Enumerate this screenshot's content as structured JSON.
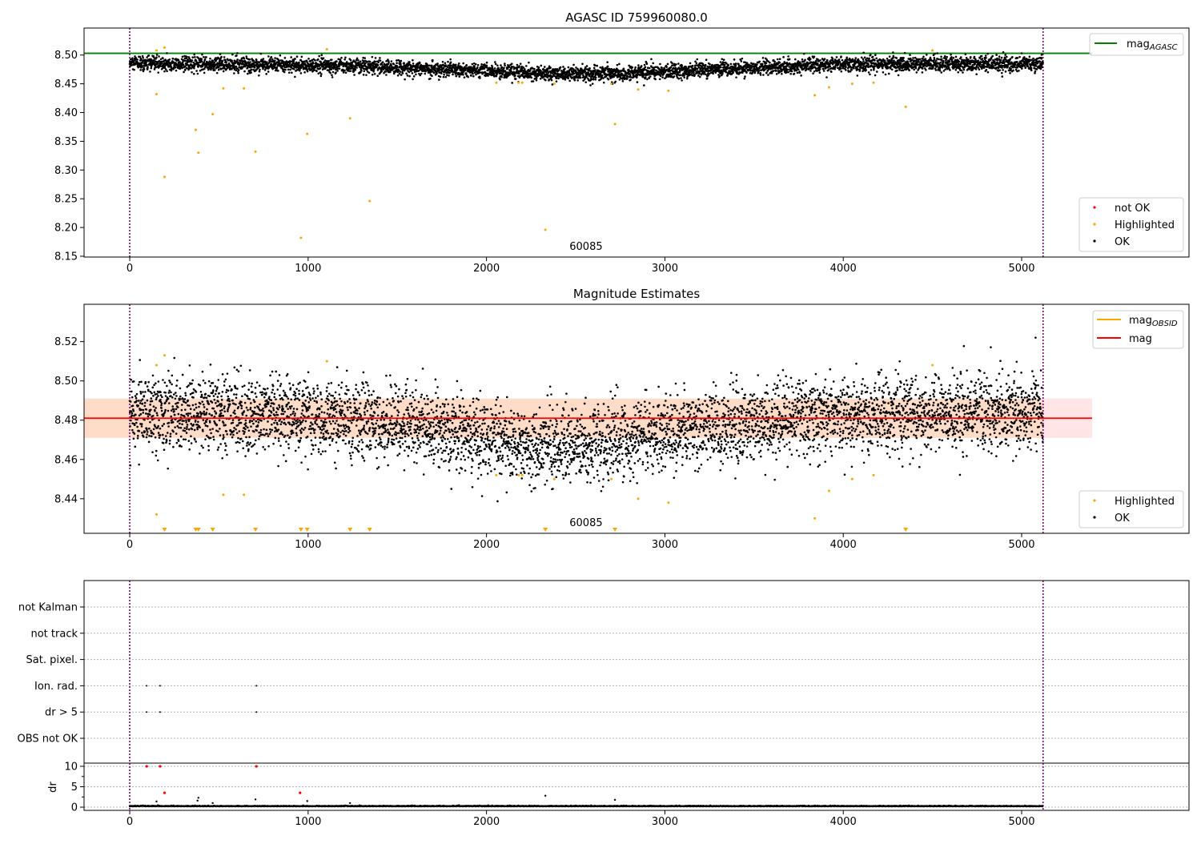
{
  "chart_data": [
    {
      "panel": "agasc",
      "type": "scatter",
      "title": "AGASC ID 759960080.0",
      "xlim": [
        -256,
        5938
      ],
      "ylim": [
        8.1486,
        8.547
      ],
      "xticks": [
        0,
        1000,
        2000,
        3000,
        4000,
        5000
      ],
      "xtick_labels": [
        "0",
        "1000",
        "2000",
        "3000",
        "4000",
        "5000"
      ],
      "yticks": [
        8.15,
        8.2,
        8.25,
        8.3,
        8.35,
        8.4,
        8.45,
        8.5
      ],
      "ytick_labels": [
        "8.15",
        "8.20",
        "8.25",
        "8.30",
        "8.35",
        "8.40",
        "8.45",
        "8.50"
      ],
      "annotation": {
        "text": "60085",
        "x": 2558
      },
      "vlines": [
        0,
        5120
      ],
      "mag_agasc": 8.503,
      "ok_series": {
        "count": 5120,
        "x_range": [
          0,
          5120
        ],
        "trend": [
          [
            0,
            8.485
          ],
          [
            800,
            8.483
          ],
          [
            1500,
            8.479
          ],
          [
            2000,
            8.472
          ],
          [
            2400,
            8.468
          ],
          [
            2800,
            8.469
          ],
          [
            3300,
            8.475
          ],
          [
            4000,
            8.484
          ],
          [
            5120,
            8.485
          ]
        ],
        "noise_sd": 0.0065
      },
      "highlighted": [
        [
          150,
          8.508
        ],
        [
          195,
          8.513
        ],
        [
          150,
          8.432
        ],
        [
          195,
          8.288
        ],
        [
          370,
          8.37
        ],
        [
          385,
          8.33
        ],
        [
          465,
          8.397
        ],
        [
          525,
          8.442
        ],
        [
          640,
          8.442
        ],
        [
          705,
          8.332
        ],
        [
          960,
          8.182
        ],
        [
          995,
          8.363
        ],
        [
          1105,
          8.51
        ],
        [
          1235,
          8.39
        ],
        [
          1345,
          8.246
        ],
        [
          2055,
          8.452
        ],
        [
          2180,
          8.452
        ],
        [
          2200,
          8.452
        ],
        [
          2330,
          8.196
        ],
        [
          2380,
          8.45
        ],
        [
          2700,
          8.45
        ],
        [
          2720,
          8.38
        ],
        [
          2850,
          8.44
        ],
        [
          3020,
          8.438
        ],
        [
          3840,
          8.43
        ],
        [
          3920,
          8.444
        ],
        [
          4050,
          8.45
        ],
        [
          4170,
          8.452
        ],
        [
          4350,
          8.41
        ],
        [
          4500,
          8.508
        ]
      ],
      "not_ok": [],
      "legend_top": {
        "line_label": "mag",
        "line_sub": "AGASC"
      },
      "legend_bottom": [
        "not OK",
        "Highlighted",
        "OK"
      ]
    },
    {
      "panel": "estimates",
      "type": "scatter",
      "title": "Magnitude Estimates",
      "xlim": [
        -256,
        5938
      ],
      "ylim": [
        8.4224,
        8.539
      ],
      "xticks": [
        0,
        1000,
        2000,
        3000,
        4000,
        5000
      ],
      "xtick_labels": [
        "0",
        "1000",
        "2000",
        "3000",
        "4000",
        "5000"
      ],
      "yticks": [
        8.44,
        8.46,
        8.48,
        8.5,
        8.52
      ],
      "ytick_labels": [
        "8.44",
        "8.46",
        "8.48",
        "8.50",
        "8.52"
      ],
      "annotation": {
        "text": "60085",
        "x": 2558
      },
      "vlines": [
        0,
        5120
      ],
      "mag": 8.481,
      "mag_band": [
        8.471,
        8.491
      ],
      "band_x_end": 5395,
      "ok_series": {
        "count": 5120,
        "x_range": [
          0,
          5120
        ],
        "trend": [
          [
            0,
            8.484
          ],
          [
            800,
            8.483
          ],
          [
            1500,
            8.479
          ],
          [
            1900,
            8.472
          ],
          [
            2300,
            8.466
          ],
          [
            2700,
            8.468
          ],
          [
            3200,
            8.476
          ],
          [
            4000,
            8.483
          ],
          [
            5120,
            8.485
          ]
        ],
        "noise_sd": 0.0095
      },
      "highlighted_ref": "same as agasc panel; values below ylim drawn as down-triangles at the bottom edge",
      "legend_top": [
        {
          "label": "mag",
          "sub": "OBSID"
        },
        {
          "label": "mag",
          "sub": ""
        }
      ],
      "legend_bottom": [
        "Highlighted",
        "OK"
      ]
    },
    {
      "panel": "flags",
      "type": "scatter",
      "categories": [
        "OBS not OK",
        "dr > 5",
        "Ion. rad.",
        "Sat. pixel.",
        "not track",
        "not Kalman"
      ],
      "points": {
        "Ion. rad.": [
          95,
          170,
          710
        ],
        "dr > 5": [
          95,
          170,
          710
        ]
      },
      "vlines": [
        0,
        5120
      ]
    },
    {
      "panel": "dr",
      "type": "scatter",
      "ylabel": "dr",
      "ylim": [
        -0.78,
        10.78
      ],
      "yticks": [
        0,
        5,
        10
      ],
      "ytick_labels": [
        "0",
        "5",
        "10"
      ],
      "xticks": [
        0,
        1000,
        2000,
        3000,
        4000,
        5000
      ],
      "xtick_labels": [
        "0",
        "1000",
        "2000",
        "3000",
        "4000",
        "5000"
      ],
      "baseline": {
        "mean": 0.2,
        "noise_sd": 0.08
      },
      "ok_outliers": [
        [
          150,
          1.4
        ],
        [
          380,
          1.6
        ],
        [
          385,
          2.3
        ],
        [
          465,
          1.0
        ],
        [
          705,
          1.9
        ],
        [
          995,
          1.5
        ],
        [
          1235,
          1.0
        ],
        [
          2330,
          2.8
        ],
        [
          2720,
          1.8
        ]
      ],
      "not_ok": [
        [
          95,
          10
        ],
        [
          170,
          10
        ],
        [
          710,
          10
        ],
        [
          195,
          3.5
        ],
        [
          955,
          3.5
        ]
      ]
    }
  ],
  "colors": {
    "ok": "#000000",
    "highlighted": "#ffa500",
    "not_ok": "#ff0000",
    "mag_agasc": "#008000",
    "mag": "#ff0000",
    "mag_obsid": "#ffa500",
    "vline": "#800080"
  }
}
